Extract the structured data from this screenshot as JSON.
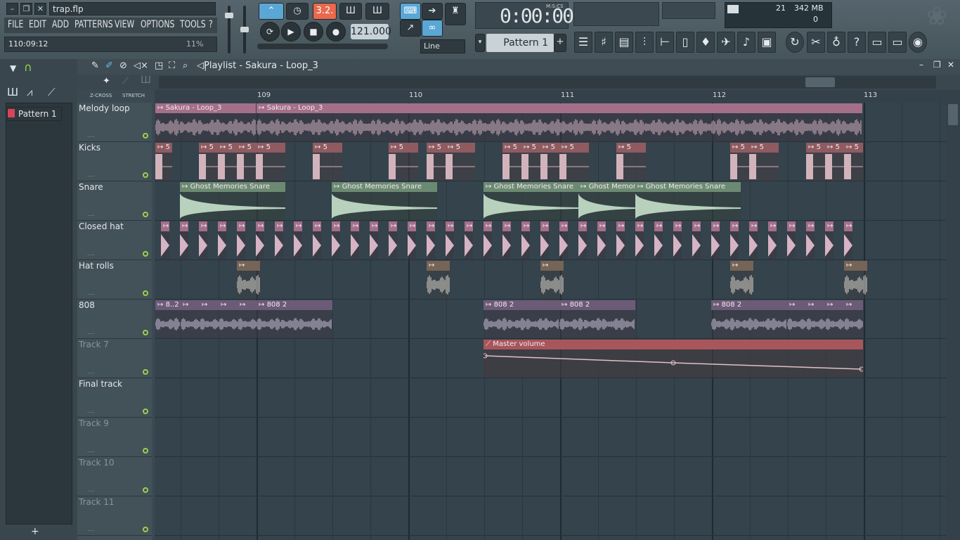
{
  "window": {
    "title": "trap.flp"
  },
  "menu": [
    "FILE",
    "EDIT",
    "ADD",
    "PATTERNS",
    "VIEW",
    "OPTIONS",
    "TOOLS",
    "?"
  ],
  "hint": {
    "time": "110:09:12",
    "percent": "11%"
  },
  "transport": {
    "pattern_song_label": "3.2.",
    "tempo": "121.000",
    "snap": "Line"
  },
  "time_display": {
    "value": "0:00:00",
    "label": "M:S:CS"
  },
  "pattern_selector": {
    "value": "Pattern 1",
    "add": "+"
  },
  "cpu": {
    "cpu_value": "21",
    "memory": "342 MB",
    "polyphony": "0"
  },
  "playlist": {
    "title": "Playlist - Sakura - Loop_3",
    "zcross": "Z-CROSS",
    "stretch": "STRETCH"
  },
  "browser": {
    "pattern": "Pattern 1",
    "add": "+"
  },
  "ruler": {
    "bars": [
      "109",
      "110",
      "111",
      "112",
      "113"
    ]
  },
  "tracks": [
    {
      "name": "Melody loop",
      "dim": false
    },
    {
      "name": "Kicks",
      "dim": false
    },
    {
      "name": "Snare",
      "dim": false
    },
    {
      "name": "Closed hat",
      "dim": false
    },
    {
      "name": "Hat rolls",
      "dim": false
    },
    {
      "name": "808",
      "dim": false
    },
    {
      "name": "Track 7",
      "dim": true
    },
    {
      "name": "Final track",
      "dim": false
    },
    {
      "name": "Track 9",
      "dim": true
    },
    {
      "name": "Track 10",
      "dim": true
    },
    {
      "name": "Track 11",
      "dim": true
    }
  ],
  "clips": {
    "melody": "Sakura - Loop_3",
    "kick": "5",
    "snare": "Ghost Memories Snare",
    "snare_short": "Ghost Memori",
    "bass": "808 2",
    "bass_short": "8..2",
    "automation": "Master volume"
  },
  "colors": {
    "accent": "#9bd04a",
    "melody": "#a46f89",
    "kick": "#8f5b61",
    "snare": "#6c8a72",
    "bass": "#6c5b77",
    "automation": "#a8565b"
  }
}
